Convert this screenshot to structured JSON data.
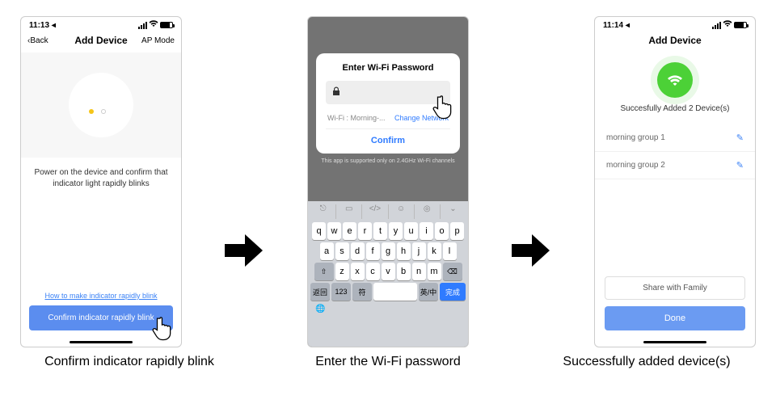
{
  "screen1": {
    "time": "11:13",
    "time_suffix": "◂",
    "back": "Back",
    "title": "Add Device",
    "ap_mode": "AP Mode",
    "instruction": "Power on the device and confirm that indicator light rapidly blinks",
    "help_link": "How to make indicator rapidly blink",
    "confirm_button": "Confirm indicator rapidly blink"
  },
  "screen2": {
    "modal_title": "Enter Wi-Fi Password",
    "wifi_label": "Wi-Fi :",
    "wifi_name": "Morning-...",
    "change_link": "Change Network",
    "confirm": "Confirm",
    "note": "This app is supported only on 2.4GHz Wi-Fi channels",
    "keys_row1": [
      "q",
      "w",
      "e",
      "r",
      "t",
      "y",
      "u",
      "i",
      "o",
      "p"
    ],
    "keys_row2": [
      "a",
      "s",
      "d",
      "f",
      "g",
      "h",
      "j",
      "k",
      "l"
    ],
    "keys_row3_shift": "⇧",
    "keys_row3": [
      "z",
      "x",
      "c",
      "v",
      "b",
      "n",
      "m"
    ],
    "keys_row3_del": "⌫",
    "row4_a": "返回",
    "row4_b": "123",
    "row4_c": "符",
    "row4_space": "",
    "row4_d": "英/中",
    "row4_done": "完成",
    "globe": "🌐"
  },
  "screen3": {
    "time": "11:14",
    "time_suffix": "◂",
    "title": "Add Device",
    "success_text": "Succesfully Added 2 Device(s)",
    "devices": [
      "morning group 1",
      "morning group 2"
    ],
    "share": "Share with Family",
    "done": "Done"
  },
  "captions": {
    "c1": "Confirm indicator rapidly blink",
    "c2": "Enter the Wi-Fi password",
    "c3": "Successfully added device(s)"
  }
}
